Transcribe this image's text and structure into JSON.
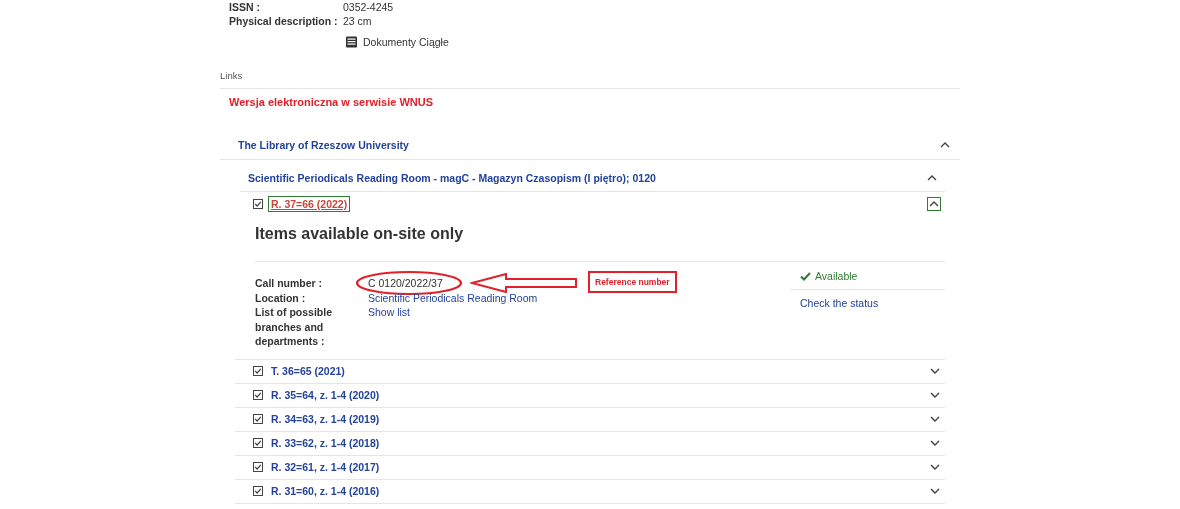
{
  "details": [
    {
      "label": "ISSN :",
      "value": "0352-4245"
    },
    {
      "label": "Physical description :",
      "value": "23 cm"
    }
  ],
  "document_type": "Dokumenty Ciągłe",
  "links": {
    "heading": "Links",
    "items": [
      "Wersja elektroniczna w serwisie WNUS"
    ]
  },
  "library": {
    "name": "The Library of Rzeszow University",
    "expanded": true,
    "room": {
      "name": "Scientific Periodicals Reading Room - magC - Magazyn Czasopism (I piętro); 0120",
      "expanded": true,
      "items": [
        {
          "title": "R. 37=66 (2022)",
          "checked": true,
          "expanded": true,
          "heading": "Items available on-site only",
          "fields": [
            {
              "label": "Call number :",
              "value": "C 0120/2022/37",
              "kind": "text"
            },
            {
              "label": "Location :",
              "value": "Scientific Periodicals Reading Room",
              "kind": "link"
            },
            {
              "label": "List of possible branches and departments :",
              "value": "Show list",
              "kind": "link"
            }
          ],
          "status": "Available",
          "status_link": "Check the status",
          "annotation": "Reference number"
        },
        {
          "title": "T. 36=65 (2021)",
          "checked": true,
          "expanded": false
        },
        {
          "title": "R. 35=64, z. 1-4 (2020)",
          "checked": true,
          "expanded": false
        },
        {
          "title": "R. 34=63, z. 1-4 (2019)",
          "checked": true,
          "expanded": false
        },
        {
          "title": "R. 33=62, z. 1-4 (2018)",
          "checked": true,
          "expanded": false
        },
        {
          "title": "R. 32=61, z. 1-4 (2017)",
          "checked": true,
          "expanded": false
        },
        {
          "title": "R. 31=60, z. 1-4 (2016)",
          "checked": true,
          "expanded": false
        }
      ]
    }
  }
}
